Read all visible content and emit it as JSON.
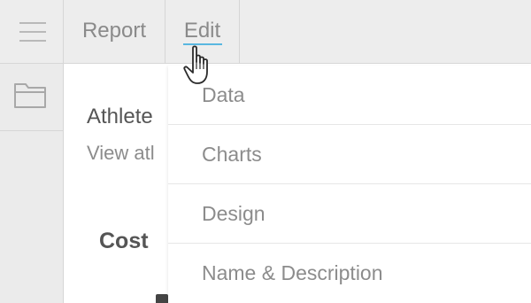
{
  "menu_bar": {
    "menu_icon": "hamburger-icon",
    "tabs": [
      {
        "label": "Report"
      },
      {
        "label": "Edit"
      }
    ],
    "active_tab": "Edit",
    "accent_color": "#59b7e0"
  },
  "left_rail": {
    "folder_icon": "folder-icon"
  },
  "report": {
    "title_fragment": "Athlete",
    "description_fragment": "View atl",
    "section_heading_fragment": "Cost"
  },
  "edit_menu": {
    "items": [
      {
        "label": "Data"
      },
      {
        "label": "Charts"
      },
      {
        "label": "Design"
      },
      {
        "label": "Name & Description"
      }
    ]
  },
  "cursor": {
    "icon": "hand-pointer-icon"
  }
}
